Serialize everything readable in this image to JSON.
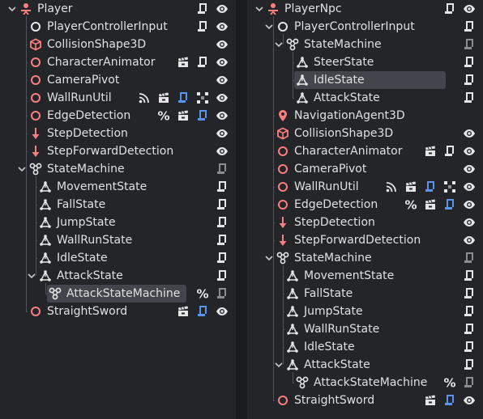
{
  "colors": {
    "panel_bg": "#232529",
    "selection_bg": "#42454b",
    "text": "#e0e0e0",
    "guide": "#50535a",
    "red_icon": "#fc7f7f",
    "blue_badge": "#5b93f0",
    "script_gray": "#8b8d92",
    "white_icon": "#e6e6e6"
  },
  "left_tree": {
    "nodes": [
      {
        "label": "Player",
        "depth": 0,
        "icon": "player-scene-icon",
        "toggle": "expanded",
        "badges": [
          "script-icon",
          "visibility-icon"
        ]
      },
      {
        "label": "PlayerControllerInput",
        "depth": 1,
        "icon": "node-circle-icon",
        "badges": [
          "script-icon",
          "visibility-icon"
        ]
      },
      {
        "label": "CollisionShape3D",
        "depth": 1,
        "icon": "collision-shape-icon",
        "badges": [
          "visibility-icon"
        ]
      },
      {
        "label": "CharacterAnimator",
        "depth": 1,
        "icon": "node3d-circle-icon",
        "badges": [
          "clapper-icon",
          "script-icon",
          "visibility-icon"
        ]
      },
      {
        "label": "CameraPivot",
        "depth": 1,
        "icon": "node3d-circle-icon",
        "badges": [
          "visibility-icon"
        ]
      },
      {
        "label": "WallRunUtil",
        "depth": 1,
        "icon": "node3d-circle-icon",
        "badges": [
          "signal-icon",
          "clapper-icon",
          "script-blue-icon",
          "group-icon",
          "visibility-icon"
        ]
      },
      {
        "label": "EdgeDetection",
        "depth": 1,
        "icon": "node3d-circle-icon",
        "badges": [
          "unique-name-icon",
          "clapper-icon",
          "script-blue-icon",
          "visibility-icon"
        ]
      },
      {
        "label": "StepDetection",
        "depth": 1,
        "icon": "raycast-icon",
        "badges": [
          "visibility-icon"
        ]
      },
      {
        "label": "StepForwardDetection",
        "depth": 1,
        "icon": "raycast-icon",
        "badges": [
          "visibility-icon"
        ]
      },
      {
        "label": "StateMachine",
        "depth": 1,
        "icon": "state-machine-icon",
        "toggle": "expanded",
        "badges": [
          "script-gray-icon"
        ]
      },
      {
        "label": "MovementState",
        "depth": 2,
        "icon": "state-icon",
        "badges": [
          "script-icon"
        ]
      },
      {
        "label": "FallState",
        "depth": 2,
        "icon": "state-icon",
        "badges": [
          "script-icon"
        ]
      },
      {
        "label": "JumpState",
        "depth": 2,
        "icon": "state-icon",
        "badges": [
          "script-icon"
        ]
      },
      {
        "label": "WallRunState",
        "depth": 2,
        "icon": "state-icon",
        "badges": [
          "script-icon"
        ]
      },
      {
        "label": "IdleState",
        "depth": 2,
        "icon": "state-icon",
        "badges": [
          "script-icon"
        ]
      },
      {
        "label": "AttackState",
        "depth": 2,
        "icon": "state-icon",
        "toggle": "expanded",
        "badges": [
          "script-icon"
        ]
      },
      {
        "label": "AttackStateMachine",
        "depth": 3,
        "icon": "state-machine-icon",
        "selected": true,
        "badges": [
          "unique-name-icon",
          "script-gray-icon"
        ]
      },
      {
        "label": "StraightSword",
        "depth": 1,
        "icon": "node3d-circle-icon",
        "badges": [
          "clapper-icon",
          "script-blue-icon",
          "visibility-icon"
        ]
      }
    ]
  },
  "right_tree": {
    "nodes": [
      {
        "label": "PlayerNpc",
        "depth": 0,
        "icon": "player-scene-icon",
        "toggle": "expanded",
        "badges": [
          "script-icon",
          "visibility-icon"
        ]
      },
      {
        "label": "PlayerControllerInput",
        "depth": 1,
        "icon": "node-circle-icon",
        "toggle": "expanded",
        "badges": [
          "script-icon"
        ]
      },
      {
        "label": "StateMachine",
        "depth": 2,
        "icon": "state-machine-icon",
        "toggle": "expanded",
        "badges": [
          "script-gray-icon"
        ]
      },
      {
        "label": "SteerState",
        "depth": 3,
        "icon": "state-icon",
        "badges": [
          "script-icon"
        ]
      },
      {
        "label": "IdleState",
        "depth": 3,
        "icon": "state-icon",
        "selected": true,
        "badges": [
          "script-icon"
        ]
      },
      {
        "label": "AttackState",
        "depth": 3,
        "icon": "state-icon",
        "badges": [
          "script-icon"
        ]
      },
      {
        "label": "NavigationAgent3D",
        "depth": 1,
        "icon": "nav-agent-icon",
        "badges": []
      },
      {
        "label": "CollisionShape3D",
        "depth": 1,
        "icon": "collision-shape-icon",
        "badges": [
          "visibility-icon"
        ]
      },
      {
        "label": "CharacterAnimator",
        "depth": 1,
        "icon": "node3d-circle-icon",
        "badges": [
          "clapper-icon",
          "script-icon",
          "visibility-icon"
        ]
      },
      {
        "label": "CameraPivot",
        "depth": 1,
        "icon": "node3d-circle-icon",
        "badges": [
          "visibility-icon"
        ]
      },
      {
        "label": "WallRunUtil",
        "depth": 1,
        "icon": "node3d-circle-icon",
        "badges": [
          "signal-icon",
          "clapper-icon",
          "script-blue-icon",
          "group-icon",
          "visibility-icon"
        ]
      },
      {
        "label": "EdgeDetection",
        "depth": 1,
        "icon": "node3d-circle-icon",
        "badges": [
          "unique-name-icon",
          "clapper-icon",
          "script-blue-icon",
          "visibility-icon"
        ]
      },
      {
        "label": "StepDetection",
        "depth": 1,
        "icon": "raycast-icon",
        "badges": [
          "visibility-icon"
        ]
      },
      {
        "label": "StepForwardDetection",
        "depth": 1,
        "icon": "raycast-icon",
        "badges": [
          "visibility-icon"
        ]
      },
      {
        "label": "StateMachine",
        "depth": 1,
        "icon": "state-machine-icon",
        "toggle": "expanded",
        "badges": [
          "script-gray-icon"
        ]
      },
      {
        "label": "MovementState",
        "depth": 2,
        "icon": "state-icon",
        "badges": [
          "script-icon"
        ]
      },
      {
        "label": "FallState",
        "depth": 2,
        "icon": "state-icon",
        "badges": [
          "script-icon"
        ]
      },
      {
        "label": "JumpState",
        "depth": 2,
        "icon": "state-icon",
        "badges": [
          "script-icon"
        ]
      },
      {
        "label": "WallRunState",
        "depth": 2,
        "icon": "state-icon",
        "badges": [
          "script-icon"
        ]
      },
      {
        "label": "IdleState",
        "depth": 2,
        "icon": "state-icon",
        "badges": [
          "script-icon"
        ]
      },
      {
        "label": "AttackState",
        "depth": 2,
        "icon": "state-icon",
        "toggle": "expanded",
        "badges": [
          "script-icon"
        ]
      },
      {
        "label": "AttackStateMachine",
        "depth": 3,
        "icon": "state-machine-icon",
        "badges": [
          "unique-name-icon",
          "script-gray-icon"
        ]
      },
      {
        "label": "StraightSword",
        "depth": 1,
        "icon": "node3d-circle-icon",
        "badges": [
          "clapper-icon",
          "script-blue-icon",
          "visibility-icon"
        ]
      }
    ]
  }
}
